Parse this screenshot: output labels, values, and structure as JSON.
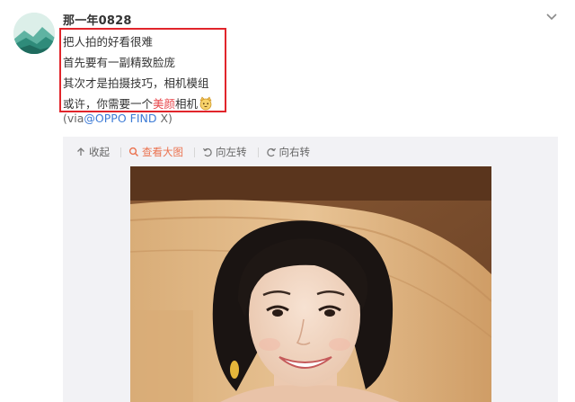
{
  "post": {
    "username": "那一年0828",
    "lines": [
      "把人拍的好看很难",
      "首先要有一副精致脸庞",
      "其次才是拍摄技巧，相机模组"
    ],
    "last_line_prefix": "或许，你需要一个",
    "last_line_highlight": "美颜",
    "last_line_suffix": "相机",
    "via_prefix": "(via",
    "via_link": "@OPPO FIND",
    "via_suffix": " X)"
  },
  "toolbar": {
    "collapse_label": "收起",
    "view_large_label": "查看大图",
    "rotate_left_label": "向左转",
    "rotate_right_label": "向右转"
  },
  "icons": {
    "menu": "chevron-down-icon",
    "collapse": "collapse-up-icon",
    "zoom": "magnifier-icon",
    "rotate_left": "rotate-left-icon",
    "rotate_right": "rotate-right-icon",
    "emoji": "cat-emoji-icon"
  },
  "colors": {
    "highlight": "#e8474c",
    "link": "#3d7bd6",
    "active_tool": "#eb7350",
    "annotation_box": "#e1252b"
  }
}
